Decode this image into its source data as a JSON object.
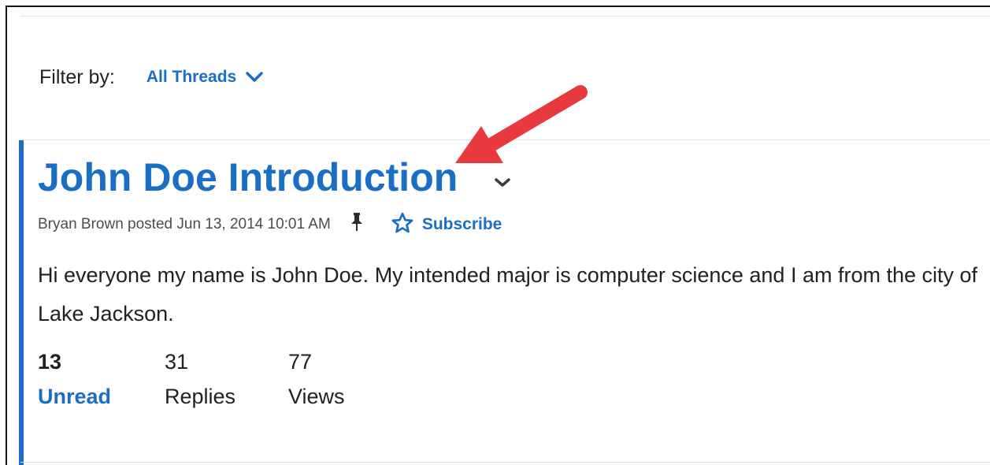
{
  "filter": {
    "label": "Filter by:",
    "selected": "All Threads",
    "dropdown_icon": "chevron-down-icon"
  },
  "thread": {
    "title": "John Doe Introduction",
    "meta": "Bryan Brown posted Jun 13, 2014 10:01 AM",
    "pinned_icon": "pin-icon",
    "subscribe_label": "Subscribe",
    "subscribe_icon": "star-outline-icon",
    "body": "Hi everyone my name is John Doe. My intended major is computer science and I am from the city of Lake Jackson.",
    "stats": [
      {
        "value": "13",
        "label": "Unread"
      },
      {
        "value": "31",
        "label": "Replies"
      },
      {
        "value": "77",
        "label": "Views"
      }
    ]
  },
  "annotation": {
    "arrow_color": "#e8393f"
  },
  "colors": {
    "accent": "#1a6fc4",
    "text": "#202122",
    "muted": "#4a4c4e"
  }
}
